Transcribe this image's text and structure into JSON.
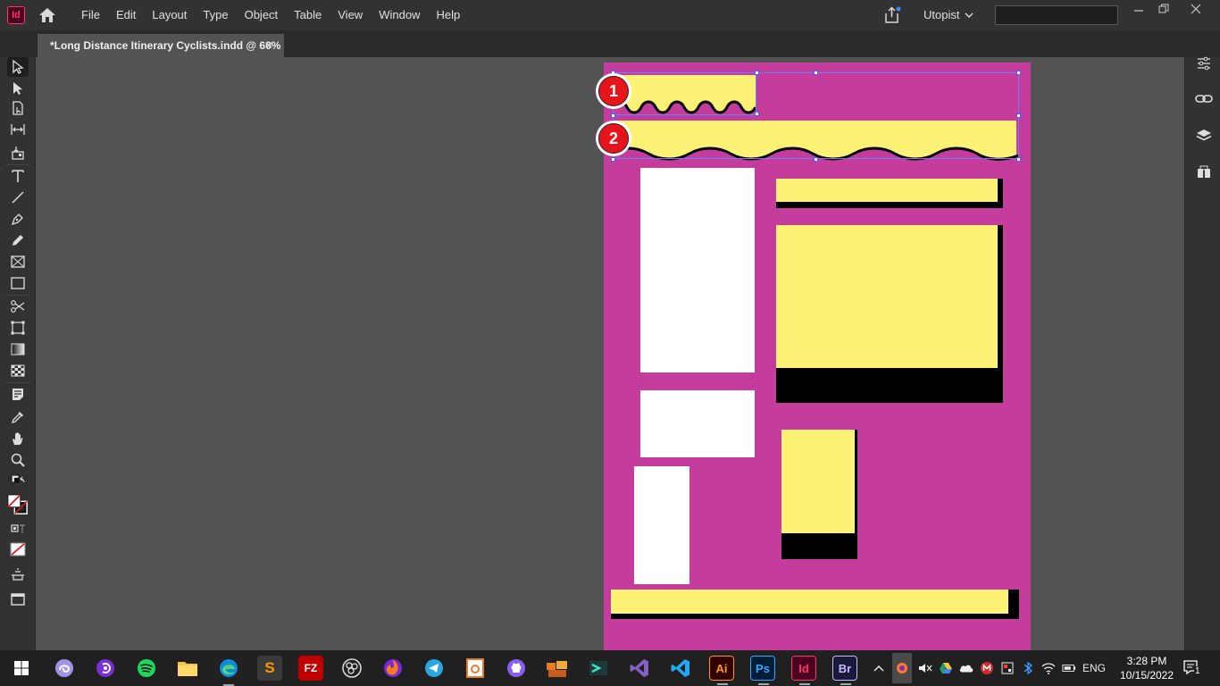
{
  "app": {
    "logo": "Id",
    "menus": [
      "File",
      "Edit",
      "Layout",
      "Type",
      "Object",
      "Table",
      "View",
      "Window",
      "Help"
    ],
    "workspace": "Utopist",
    "search_value": ""
  },
  "document": {
    "tab_title": "*Long Distance Itinerary Cyclists.indd @ 60%",
    "close_glyph": "✕"
  },
  "annotations": {
    "badge1": "1",
    "badge2": "2"
  },
  "taskbar": {
    "time": "3:28 PM",
    "date": "10/15/2022",
    "language": "ENG",
    "apps": [
      {
        "name": "start",
        "label": ""
      },
      {
        "name": "app-swirl",
        "label": ""
      },
      {
        "name": "app-purple",
        "label": ""
      },
      {
        "name": "spotify",
        "label": ""
      },
      {
        "name": "file-explorer",
        "label": ""
      },
      {
        "name": "edge",
        "label": ""
      },
      {
        "name": "sublime-text",
        "label": "S"
      },
      {
        "name": "filezilla",
        "label": "FZ"
      },
      {
        "name": "obs",
        "label": ""
      },
      {
        "name": "firefox",
        "label": ""
      },
      {
        "name": "telegram",
        "label": ""
      },
      {
        "name": "app-orange",
        "label": ""
      },
      {
        "name": "github",
        "label": ""
      },
      {
        "name": "app-grid",
        "label": ""
      },
      {
        "name": "app-teal",
        "label": ""
      },
      {
        "name": "visual-studio",
        "label": ""
      },
      {
        "name": "vscode",
        "label": ""
      },
      {
        "name": "illustrator",
        "label": "Ai"
      },
      {
        "name": "photoshop",
        "label": "Ps"
      },
      {
        "name": "indesign",
        "label": "Id"
      },
      {
        "name": "bridge",
        "label": "Br"
      }
    ],
    "notification_count": "1"
  }
}
